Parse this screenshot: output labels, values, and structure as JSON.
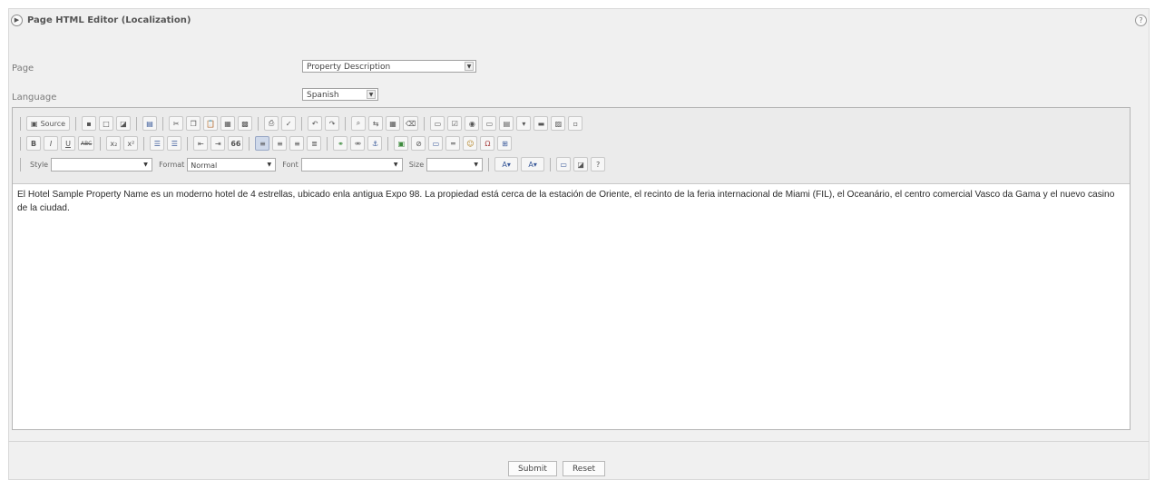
{
  "header": {
    "title": "Page HTML Editor (Localization)",
    "help": "?"
  },
  "form": {
    "page_label": "Page",
    "page_value": "Property Description",
    "language_label": "Language",
    "language_value": "Spanish"
  },
  "toolbar": {
    "source_label": "Source",
    "bold": "B",
    "italic": "I",
    "underline": "U",
    "strike": "ABC",
    "subscript": "x₂",
    "superscript": "x²",
    "blockquote": "66",
    "style_label": "Style",
    "style_value": "",
    "format_label": "Format",
    "format_value": "Normal",
    "font_label": "Font",
    "font_value": "",
    "size_label": "Size",
    "size_value": "",
    "help": "?"
  },
  "editor": {
    "content": "El Hotel Sample Property Name es un moderno hotel de 4 estrellas, ubicado enla antigua Expo 98. La propiedad está cerca de la estación de Oriente, el recinto de la feria internacional de Miami (FIL), el Oceanário, el centro comercial Vasco da Gama y el nuevo casino de la ciudad."
  },
  "actions": {
    "submit": "Submit",
    "reset": "Reset"
  }
}
